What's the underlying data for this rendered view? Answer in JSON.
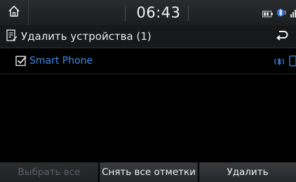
{
  "status_bar": {
    "time": "06:43",
    "icons": [
      "home-icon",
      "battery-icon",
      "bluetooth-phone-icon",
      "signal-icon"
    ]
  },
  "title_bar": {
    "title": "Удалить устройства (1)",
    "title_icon": "list-edit-icon",
    "back_icon": "back-arrow-icon"
  },
  "devices": [
    {
      "label": "Smart Phone",
      "checked": true,
      "icons": [
        "bluetooth-audio-icon",
        "phone-icon"
      ]
    }
  ],
  "buttons": {
    "select_all": "Выбрать все",
    "unmark_all": "Снять все отметки",
    "delete": "Удалить"
  },
  "colors": {
    "accent": "#3f8be8",
    "background": "#000000",
    "disabled_text": "#5e6064"
  }
}
